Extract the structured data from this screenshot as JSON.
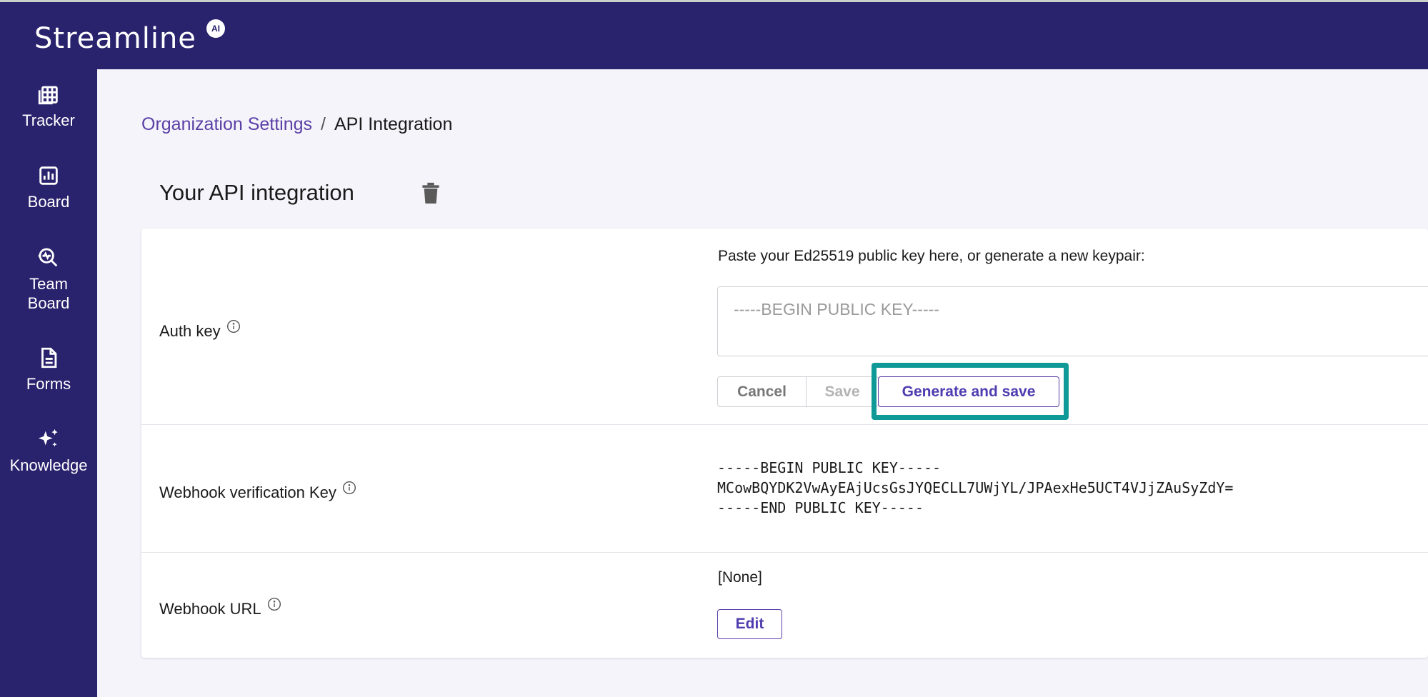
{
  "app": {
    "logo_text": "Streamline",
    "logo_badge": "AI",
    "brand_color": "#29226d",
    "accent_color": "#5b3fa6",
    "highlight_color": "#0f9a97"
  },
  "sidebar": {
    "items": [
      {
        "label": "Tracker",
        "icon": "table-icon"
      },
      {
        "label": "Board",
        "icon": "bar-chart-icon"
      },
      {
        "label": "Team Board",
        "icon": "team-search-icon"
      },
      {
        "label": "Forms",
        "icon": "document-icon"
      },
      {
        "label": "Knowledge",
        "icon": "sparkles-icon"
      }
    ]
  },
  "breadcrumb": {
    "parent": "Organization Settings",
    "separator": "/",
    "current": "API Integration"
  },
  "page": {
    "title": "Your API integration"
  },
  "auth_key": {
    "label": "Auth key",
    "hint": "Paste your Ed25519 public key here, or generate a new keypair:",
    "placeholder": "-----BEGIN PUBLIC KEY-----",
    "value": "",
    "cancel_label": "Cancel",
    "save_label": "Save",
    "generate_label": "Generate and save"
  },
  "webhook_key": {
    "label": "Webhook verification Key",
    "lines": [
      "-----BEGIN PUBLIC KEY-----",
      "MCowBQYDK2VwAyEAjUcsGsJYQECLL7UWjYL/JPAexHe5UCT4VJjZAuSyZdY=",
      "-----END PUBLIC KEY-----"
    ]
  },
  "webhook_url": {
    "label": "Webhook URL",
    "value": "[None]",
    "edit_label": "Edit"
  }
}
